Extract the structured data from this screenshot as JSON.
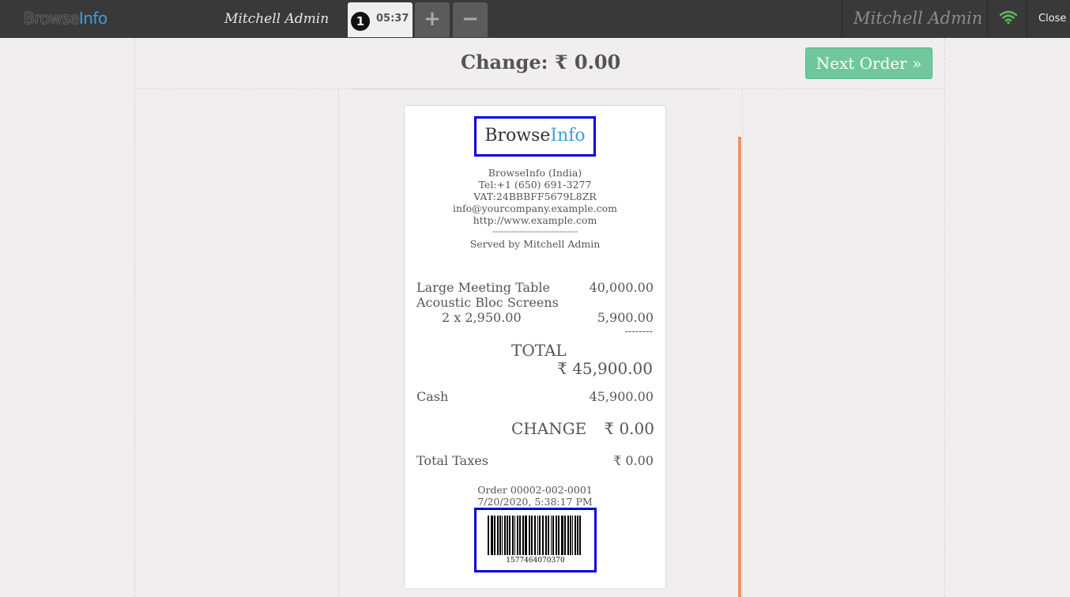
{
  "topbar": {
    "logo_part1": "Browse",
    "logo_part2": "Info",
    "cashier": "Mitchell Admin",
    "order_tab_number": "1",
    "order_tab_time": "05:37",
    "add_order_label": "+",
    "remove_order_label": "−",
    "cashier_right": "Mitchell Admin",
    "close_label": "Close",
    "wifi_icon": "wifi-icon",
    "wifi_color": "#5cb85c"
  },
  "screen": {
    "change_title": "Change: ₹ 0.00",
    "next_order_label": "Next Order »",
    "next_order_color": "#6ec89b"
  },
  "receipt": {
    "logo_part1": "Browse",
    "logo_part2": "Info",
    "company": "BrowseInfo (India)",
    "tel": "Tel:+1 (650) 691-3277",
    "vat": "VAT:24BBBFF5679L8ZR",
    "email": "info@yourcompany.example.com",
    "website": "http://www.example.com",
    "separator": "--------------------------------",
    "served_by": "Served by Mitchell Admin",
    "lines": [
      {
        "name": "Large Meeting Table",
        "price": "40,000.00"
      },
      {
        "name": "Acoustic Bloc Screens",
        "price": ""
      },
      {
        "name": "2 x 2,950.00",
        "price": "5,900.00"
      }
    ],
    "dashes": "--------",
    "total_label": "TOTAL",
    "total_value": "₹ 45,900.00",
    "payment_label": "Cash",
    "payment_value": "45,900.00",
    "change_label": "CHANGE",
    "change_value": "₹ 0.00",
    "taxes_label": "Total Taxes",
    "taxes_value": "₹ 0.00",
    "order_ref": "Order 00002-002-0001",
    "order_date": "7/20/2020, 5:38:17 PM",
    "barcode_number": "1577464070370"
  }
}
